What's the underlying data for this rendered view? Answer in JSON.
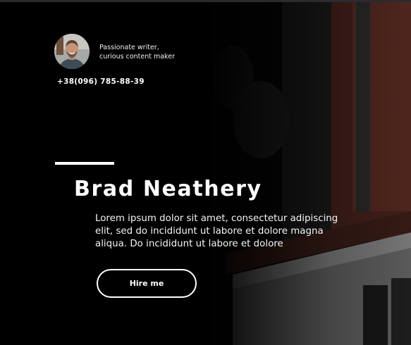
{
  "profile": {
    "tagline_line1": "Passionate writer,",
    "tagline_line2": "curious content maker",
    "phone": "+38(096) 785-88-39"
  },
  "hero": {
    "name": "Brad Neathery",
    "bio_line1": "Lorem ipsum dolor sit amet, consectetur adipiscing",
    "bio_line2": "elit, sed do incididunt ut labore et dolore magna",
    "bio_line3": "aliqua. Do incididunt ut labore et dolore",
    "cta_label": "Hire me"
  },
  "colors": {
    "background": "#000000",
    "text": "#ffffff",
    "brick": "#5a2a22"
  }
}
